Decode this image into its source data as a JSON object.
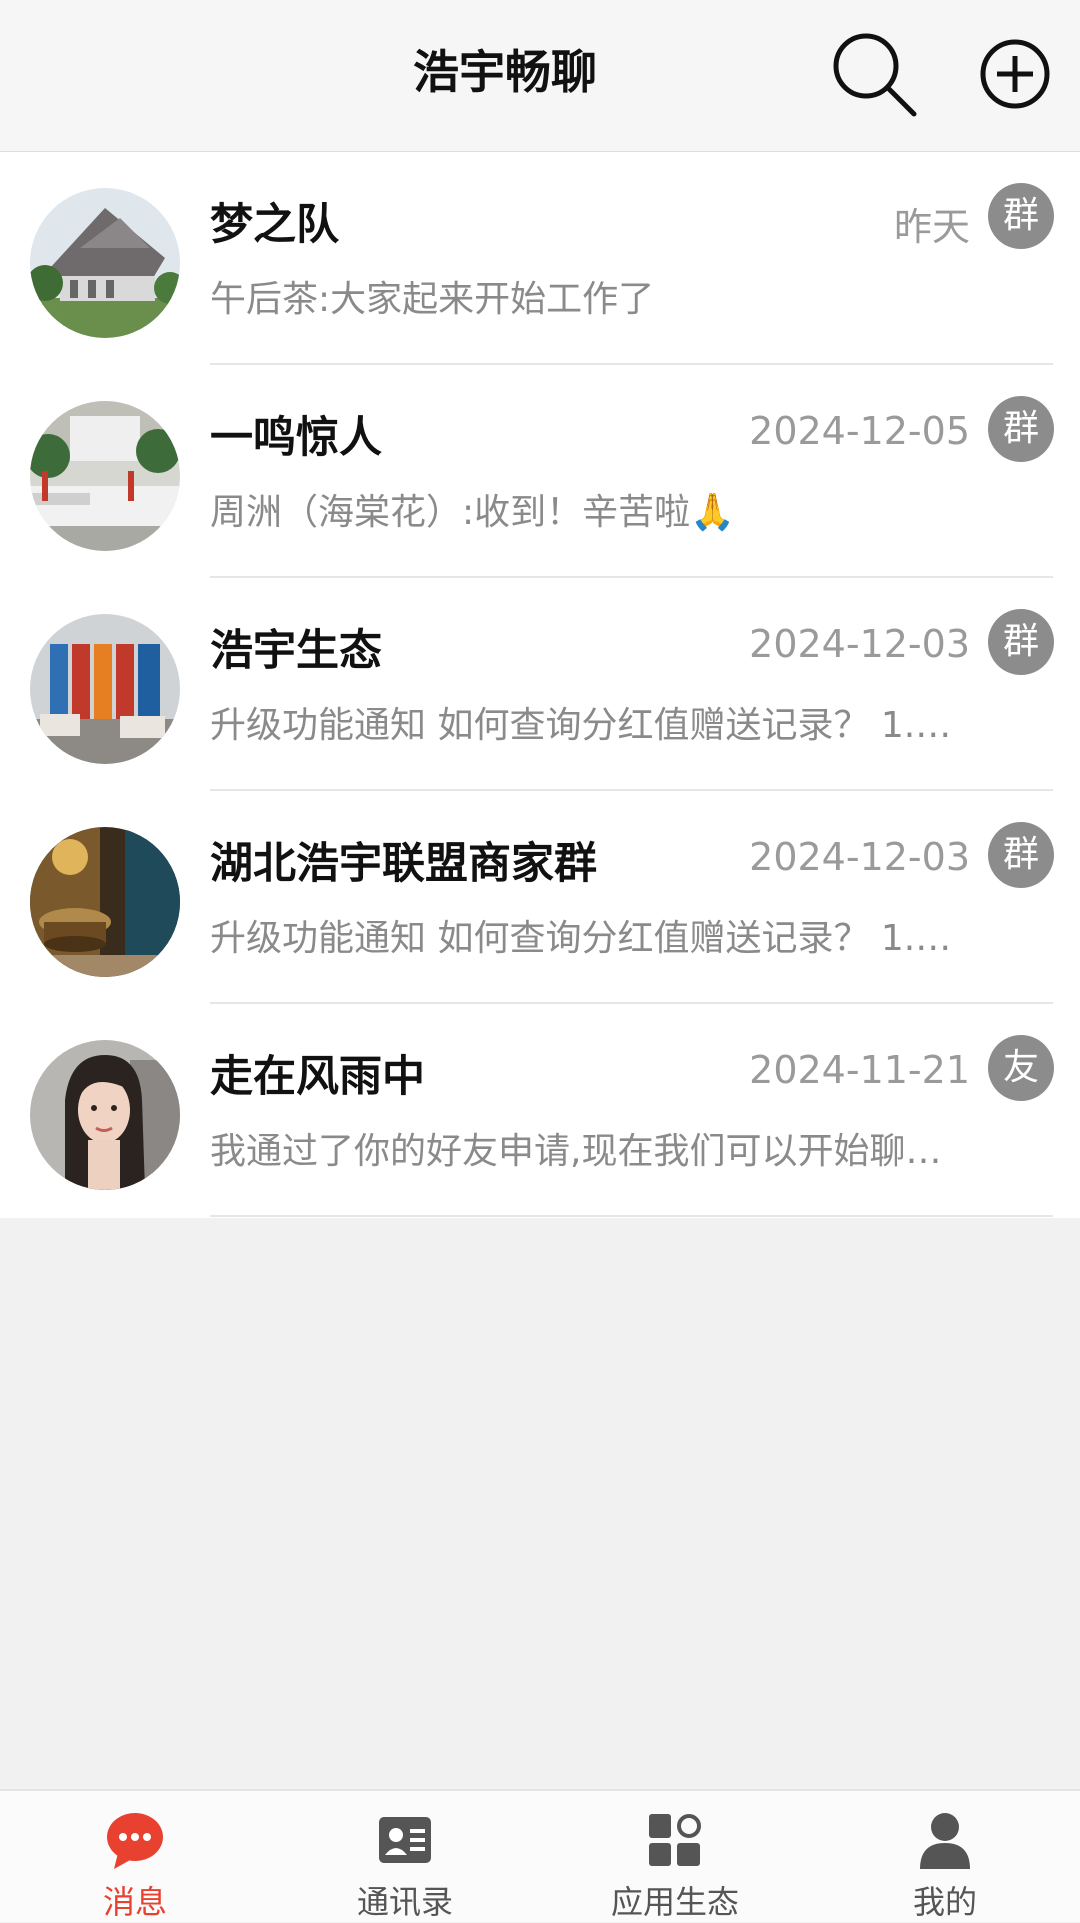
{
  "header": {
    "title": "浩宇畅聊",
    "search_icon": "search-icon",
    "add_icon": "plus-circle-icon"
  },
  "conversations": [
    {
      "name": "梦之队",
      "time": "昨天",
      "badge": "群",
      "preview": "午后茶:大家起来开始工作了",
      "avatar": "building-photo"
    },
    {
      "name": "一鸣惊人",
      "time": "2024-12-05",
      "badge": "群",
      "preview": "周洲（海棠花）:收到！辛苦啦🙏",
      "avatar": "office-lobby-photo"
    },
    {
      "name": "浩宇生态",
      "time": "2024-12-03",
      "badge": "群",
      "preview": "升级功能通知 如何查询分红值赠送记录？ 1.…",
      "avatar": "display-boards-photo"
    },
    {
      "name": "湖北浩宇联盟商家群",
      "time": "2024-12-03",
      "badge": "群",
      "preview": "升级功能通知 如何查询分红值赠送记录？ 1.…",
      "avatar": "bronze-vessel-photo"
    },
    {
      "name": "走在风雨中",
      "time": "2024-11-21",
      "badge": "友",
      "preview": "我通过了你的好友申请,现在我们可以开始聊…",
      "avatar": "woman-portrait-photo"
    }
  ],
  "tabbar": {
    "active_color": "#e8412f",
    "items": [
      {
        "label": "消息",
        "icon": "chat-bubble-icon",
        "active": true
      },
      {
        "label": "通讯录",
        "icon": "contact-card-icon",
        "active": false
      },
      {
        "label": "应用生态",
        "icon": "apps-grid-icon",
        "active": false
      },
      {
        "label": "我的",
        "icon": "person-icon",
        "active": false
      }
    ]
  }
}
